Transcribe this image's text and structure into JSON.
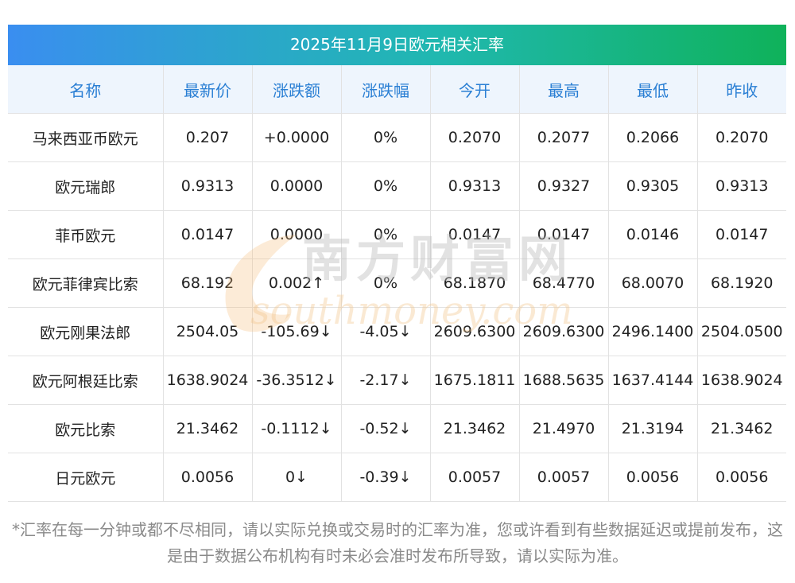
{
  "title": "2025年11月9日欧元相关汇率",
  "headers": [
    "名称",
    "最新价",
    "涨跌额",
    "涨跌幅",
    "今开",
    "最高",
    "最低",
    "昨收"
  ],
  "rows": [
    {
      "name": "马来西亚币欧元",
      "latest": "0.207",
      "change": "+0.0000",
      "pct": "0%",
      "open": "0.2070",
      "high": "0.2077",
      "low": "0.2066",
      "prev": "0.2070",
      "trend": "flat"
    },
    {
      "name": "欧元瑞郎",
      "latest": "0.9313",
      "change": "0.0000",
      "pct": "0%",
      "open": "0.9313",
      "high": "0.9327",
      "low": "0.9305",
      "prev": "0.9313",
      "trend": "flat"
    },
    {
      "name": "菲币欧元",
      "latest": "0.0147",
      "change": "0.0000",
      "pct": "0%",
      "open": "0.0147",
      "high": "0.0147",
      "low": "0.0146",
      "prev": "0.0147",
      "trend": "flat"
    },
    {
      "name": "欧元菲律宾比索",
      "latest": "68.192",
      "change": "0.002↑",
      "pct": "0%",
      "open": "68.1870",
      "high": "68.4770",
      "low": "68.0070",
      "prev": "68.1920",
      "trend": "up"
    },
    {
      "name": "欧元刚果法郎",
      "latest": "2504.05",
      "change": "-105.69↓",
      "pct": "-4.05↓",
      "open": "2609.6300",
      "high": "2609.6300",
      "low": "2496.1400",
      "prev": "2504.0500",
      "trend": "down"
    },
    {
      "name": "欧元阿根廷比索",
      "latest": "1638.9024",
      "change": "-36.3512↓",
      "pct": "-2.17↓",
      "open": "1675.1811",
      "high": "1688.5635",
      "low": "1637.4144",
      "prev": "1638.9024",
      "trend": "down"
    },
    {
      "name": "欧元比索",
      "latest": "21.3462",
      "change": "-0.1112↓",
      "pct": "-0.52↓",
      "open": "21.3462",
      "high": "21.4970",
      "low": "21.3194",
      "prev": "21.3462",
      "trend": "down"
    },
    {
      "name": "日元欧元",
      "latest": "0.0056",
      "change": "0↓",
      "pct": "-0.39↓",
      "open": "0.0057",
      "high": "0.0057",
      "low": "0.0056",
      "prev": "0.0056",
      "trend": "down"
    }
  ],
  "watermark": {
    "cn": "南方财富网",
    "en": "southmoney.com"
  },
  "footnote": "*汇率在每一分钟或都不尽相同，请以实际兑换或交易时的汇率为准，您或许看到有些数据延迟或提前发布，这是由于数据公布机构有时未必会准时发布所导致，请以实际为准。",
  "colors": {
    "up": "#e0201e",
    "down": "#1b8f1b",
    "header_text": "#2a7fd4",
    "title_gradient_start": "#3a8ef0",
    "title_gradient_end": "#0fb25a"
  }
}
